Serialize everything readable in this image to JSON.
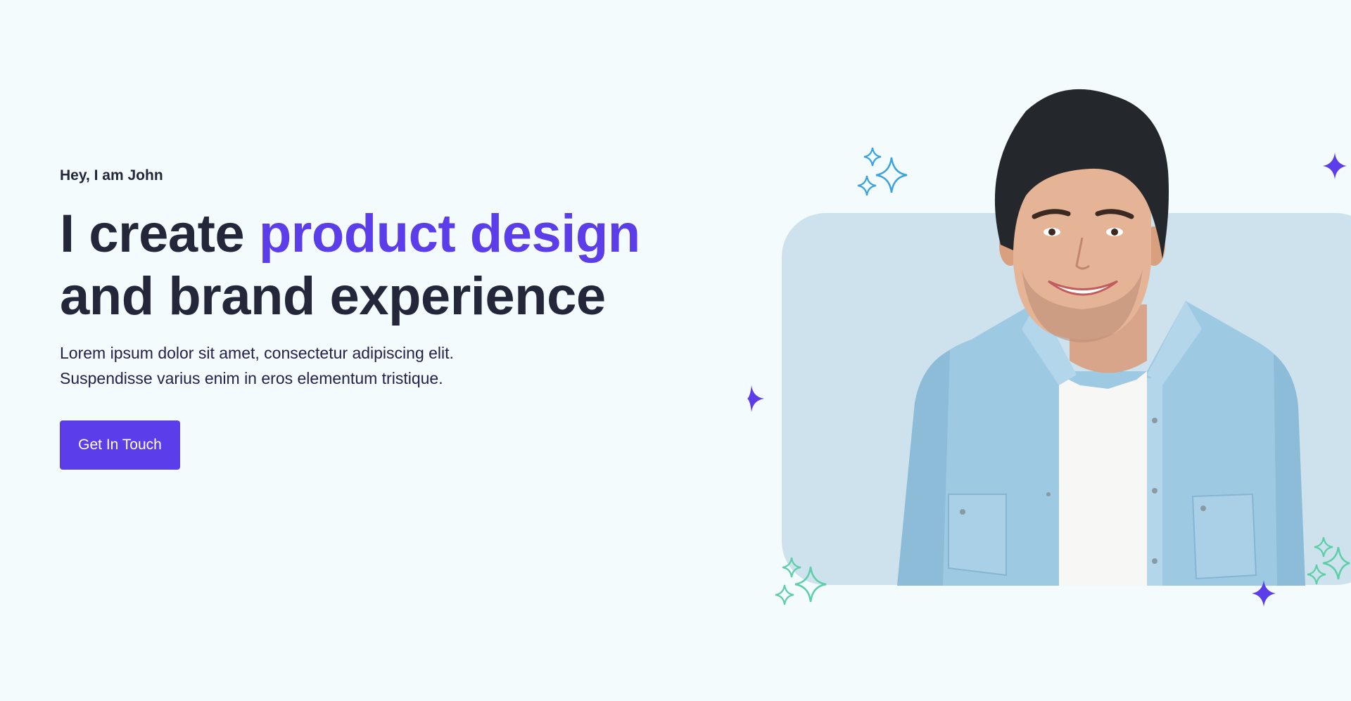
{
  "hero": {
    "greeting": "Hey, I am John",
    "headline_start": "I create ",
    "headline_accent": "product design",
    "headline_end": "and brand experience",
    "description_line1": "Lorem ipsum dolor sit amet, consectetur adipiscing elit.",
    "description_line2": "Suspendisse varius enim in eros elementum tristique.",
    "cta_label": "Get In Touch"
  },
  "colors": {
    "background": "#f4fbfd",
    "text_dark": "#24263a",
    "accent": "#5b3de9",
    "photo_card": "#cde2ec",
    "sparkle_blue": "#3aa3e0",
    "sparkle_green": "#5ccfa7",
    "sparkle_purple": "#5b3de9"
  },
  "icons": {
    "decorations": [
      "sparkle-icon",
      "star-icon"
    ]
  }
}
